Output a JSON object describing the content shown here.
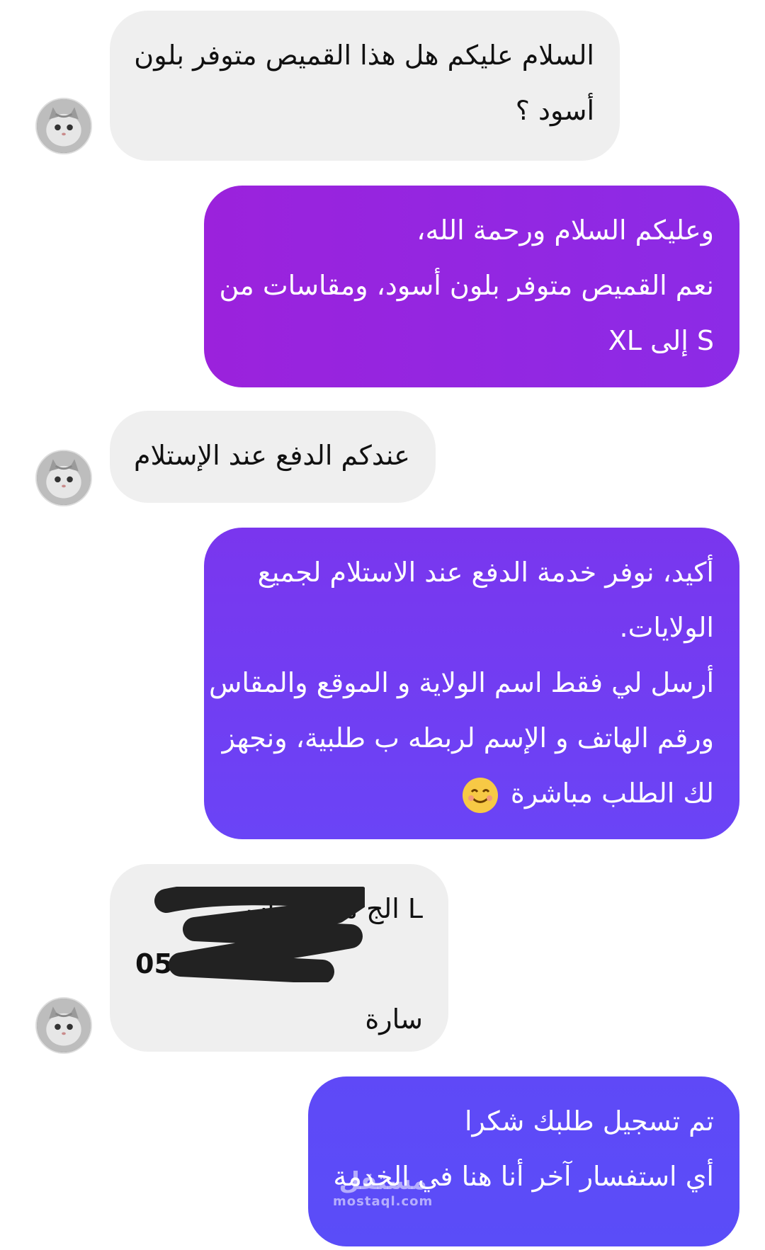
{
  "messages": [
    {
      "sender": "customer",
      "lines": [
        "السلام عليكم هل هذا القميص متوفر بلون",
        "أسود ؟"
      ]
    },
    {
      "sender": "seller",
      "lines": [
        "وعليكم السلام ورحمة الله،",
        "نعم القميص متوفر بلون أسود، ومقاسات من",
        "S إلى XL"
      ]
    },
    {
      "sender": "customer",
      "lines": [
        "عندكم الدفع عند الإستلام"
      ]
    },
    {
      "sender": "seller",
      "lines": [
        "أكيد، نوفر خدمة الدفع عند الاستلام لجميع",
        "الولايات.",
        "أرسل لي فقط اسم الولاية و الموقع والمقاس",
        "ورقم الهاتف و الإسم لربطه ب طلبية، ونجهز",
        "لك الطلب مباشرة"
      ],
      "emoji": "smiling-face-icon"
    },
    {
      "sender": "customer",
      "lines": [
        "L الج          مة المقاس",
        "05",
        "سارة"
      ],
      "redacted": true
    },
    {
      "sender": "seller",
      "lines": [
        "تم تسجيل طلبك شكرا",
        "أي استفسار آخر أنا هنا في الخدمة"
      ]
    }
  ],
  "colors": {
    "incoming_bg": "#efefef",
    "seller_gradient_1": [
      "#9b22dc",
      "#8c2be6"
    ],
    "seller_gradient_2": [
      "#7a36ee",
      "#6a44f6"
    ],
    "seller_gradient_3": [
      "#5f49f7",
      "#5a4df8"
    ]
  },
  "watermark": {
    "arabic": "مستقل",
    "latin": "mostaql.com"
  }
}
